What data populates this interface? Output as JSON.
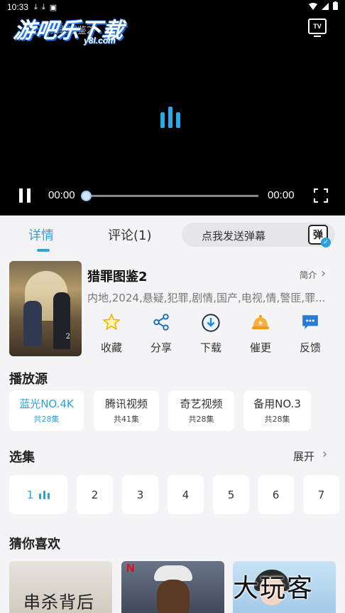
{
  "status_bar": {
    "time": "10:33",
    "left_icons": [
      "download-icon",
      "download-icon",
      "app-icon"
    ],
    "right_icons": [
      "wifi-icon",
      "signal-icon",
      "battery-icon"
    ]
  },
  "watermark": {
    "logo": "游吧乐下载",
    "sub": "y8l.com",
    "bottom": "大玩客"
  },
  "player": {
    "title": "猎罪图鉴2",
    "tv_label": "TV",
    "current_time": "00:00",
    "duration": "00:00",
    "progress": 0,
    "accent": "#2aa3e0"
  },
  "tabs": {
    "details": "详情",
    "comments": "评论(1)",
    "danmu_placeholder": "点我发送弹幕",
    "danmu_icon": "弹"
  },
  "show": {
    "poster_text": "2",
    "title": "猎罪图鉴2",
    "intro_label": "简介",
    "tags": "内地,2024,悬疑,犯罪,剧情,国产,电视,情,警匪,罪..."
  },
  "actions": [
    {
      "label": "收藏",
      "icon": "star-icon"
    },
    {
      "label": "分享",
      "icon": "share-icon"
    },
    {
      "label": "下载",
      "icon": "download-icon"
    },
    {
      "label": "催更",
      "icon": "bell-icon"
    },
    {
      "label": "反馈",
      "icon": "feedback-icon"
    }
  ],
  "sources": {
    "title": "播放源",
    "items": [
      {
        "name": "蓝光NO.4K",
        "count": "共28集",
        "active": true
      },
      {
        "name": "腾讯视频",
        "count": "共41集",
        "active": false
      },
      {
        "name": "奇艺视频",
        "count": "共28集",
        "active": false
      },
      {
        "name": "备用NO.3",
        "count": "共28集",
        "active": false
      }
    ]
  },
  "episodes": {
    "title": "选集",
    "expand": "展开",
    "items": [
      "1",
      "2",
      "3",
      "4",
      "5",
      "6",
      "7"
    ],
    "active": "1"
  },
  "recommend": {
    "title": "猜你喜欢",
    "items": [
      {
        "poster_text": "串杀背后"
      },
      {
        "poster_text": "N"
      },
      {
        "poster_text": ""
      }
    ]
  }
}
